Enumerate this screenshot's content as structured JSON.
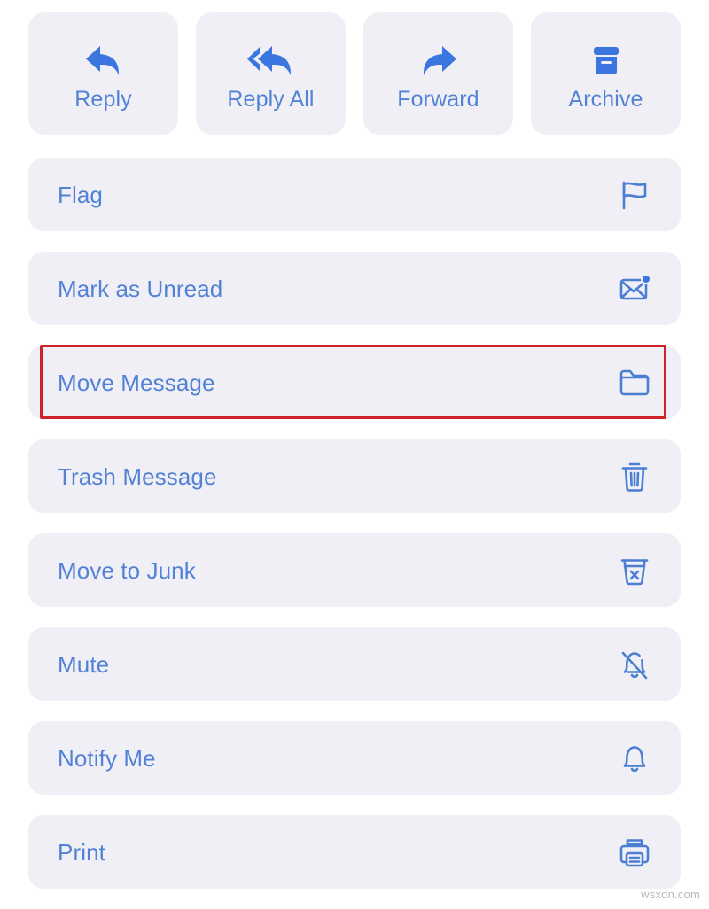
{
  "quick_actions": [
    {
      "label": "Reply",
      "icon": "reply-arrow-icon"
    },
    {
      "label": "Reply All",
      "icon": "reply-all-arrow-icon"
    },
    {
      "label": "Forward",
      "icon": "forward-arrow-icon"
    },
    {
      "label": "Archive",
      "icon": "archive-box-icon"
    }
  ],
  "menu_items": [
    {
      "label": "Flag",
      "icon": "flag-icon",
      "highlighted": false
    },
    {
      "label": "Mark as Unread",
      "icon": "envelope-badge-icon",
      "highlighted": false
    },
    {
      "label": "Move Message",
      "icon": "folder-icon",
      "highlighted": true
    },
    {
      "label": "Trash Message",
      "icon": "trash-icon",
      "highlighted": false
    },
    {
      "label": "Move to Junk",
      "icon": "junk-bin-x-icon",
      "highlighted": false
    },
    {
      "label": "Mute",
      "icon": "bell-slash-icon",
      "highlighted": false
    },
    {
      "label": "Notify Me",
      "icon": "bell-icon",
      "highlighted": false
    },
    {
      "label": "Print",
      "icon": "printer-icon",
      "highlighted": false
    }
  ],
  "watermark": "wsxdn.com",
  "colors": {
    "accent_blue": "#5282d6",
    "icon_blue_filled": "#3b76e0",
    "row_background": "#f0eff5",
    "page_background": "#ffffff",
    "highlight_red": "#cc2229"
  }
}
